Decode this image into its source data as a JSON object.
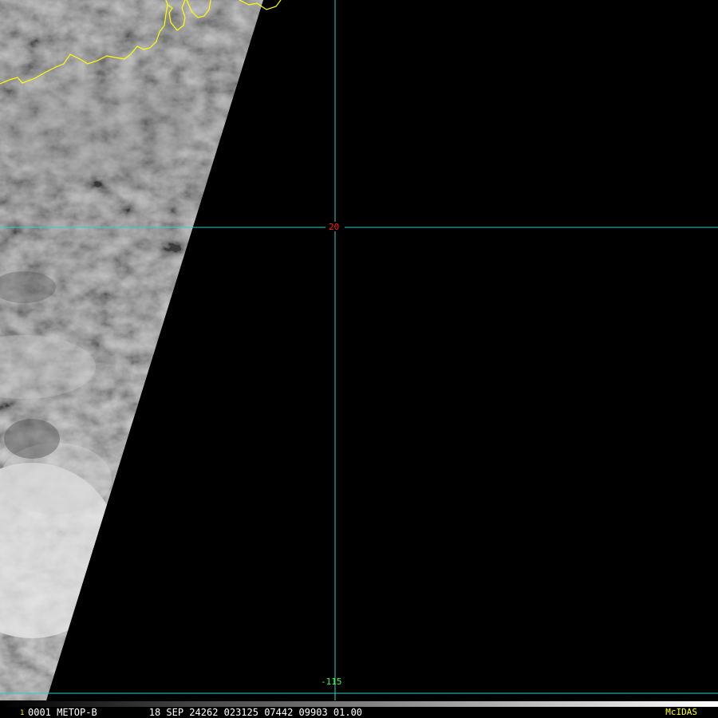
{
  "map": {
    "grid": {
      "color": "#33cccc",
      "latitude_label": "20",
      "latitude_label_color": "#ff2020",
      "longitude_label": "-115",
      "longitude_label_color": "#33ff33"
    },
    "coastline_color": "#ffff00",
    "no_data_color": "#000000"
  },
  "status_bar": {
    "frame_number": "1",
    "info_text": "0001 METOP-B         18 SEP 24262 023125 07442 09903 01.00",
    "brand": "McIDAS",
    "brand_color": "#ffff00"
  }
}
